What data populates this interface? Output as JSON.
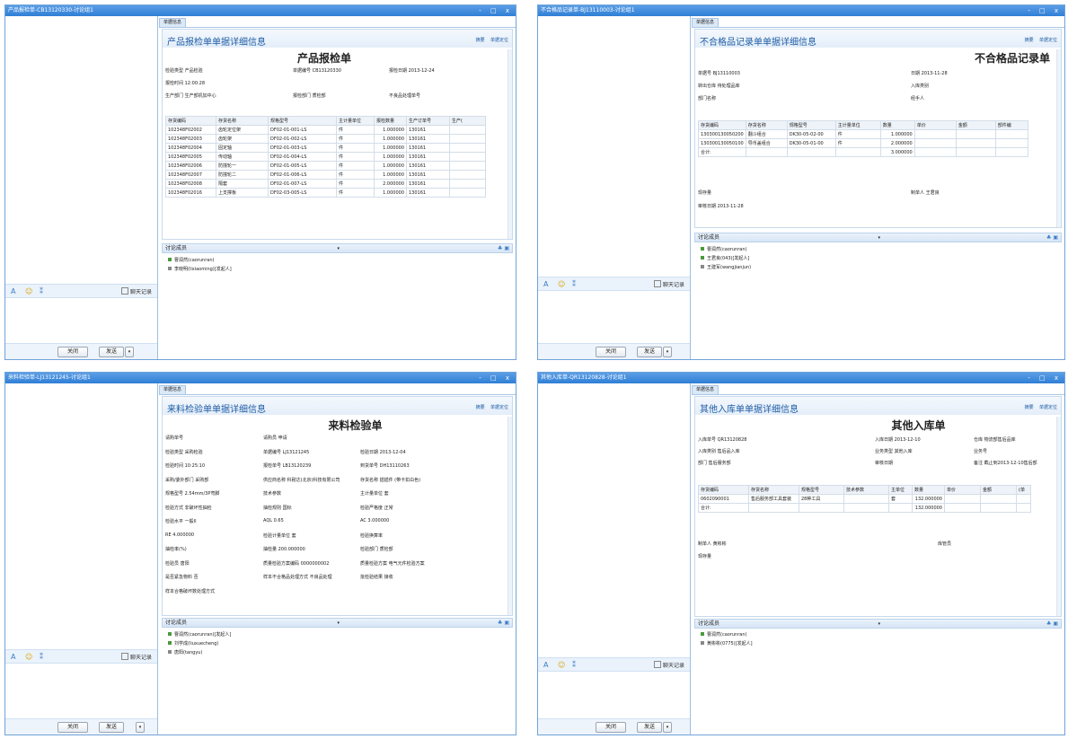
{
  "common": {
    "close_label": "关闭",
    "send_label": "发送",
    "chat_record_label": "聊天记录",
    "discussion_label": "讨论成员",
    "tab_label": "单据信息",
    "summary_link": "摘要",
    "locate_link": "单据定位",
    "window_controls": "- □ x",
    "dropdown_arrow": "▾",
    "font_icon": "A",
    "emoji_icon": "☺",
    "shake_icon": "⁑",
    "accent_color": "#2f7fd6"
  },
  "w1": {
    "title": "产品报检单-CB13120330-讨论组1",
    "doc_header": "产品报检单单据详细信息",
    "doc_title": "产品报检单",
    "fields": {
      "a1": "检验类型 产品检验",
      "a2": "单据编号 CB13120330",
      "a3": "报检日期 2013-12-24",
      "b1": "报检时间 12:00:28",
      "c1": "生产部门 生产部机加中心",
      "c2": "报检部门 质检部",
      "c3": "不良品处理单号"
    },
    "table": {
      "headers": [
        "存货编码",
        "存货名称",
        "规格型号",
        "主计量单位",
        "报检数量",
        "生产订单号",
        "生产("
      ],
      "rows": [
        [
          "102348F02002",
          "齿轮定位架",
          "DF02-01-001-LS",
          "件",
          "1.000000",
          "130161",
          ""
        ],
        [
          "102348F02003",
          "齿轮架",
          "DF02-01-002-LS",
          "件",
          "1.000000",
          "130161",
          ""
        ],
        [
          "102348F02004",
          "固定轴",
          "DF02-01-003-LS",
          "件",
          "1.000000",
          "130161",
          ""
        ],
        [
          "102348F02005",
          "传动轴",
          "DF02-01-004-LS",
          "件",
          "1.000000",
          "130161",
          ""
        ],
        [
          "102348F02006",
          "防撞轮一",
          "DF02-01-005-LS",
          "件",
          "1.000000",
          "130161",
          ""
        ],
        [
          "102348F02007",
          "防撞轮二",
          "DF02-01-006-LS",
          "件",
          "1.000000",
          "130161",
          ""
        ],
        [
          "102348F02008",
          "隔套",
          "DF02-01-007-LS",
          "件",
          "2.000000",
          "130161",
          ""
        ],
        [
          "102348F02016",
          "上支撑板",
          "DF02-03-005-LS",
          "件",
          "1.000000",
          "130161",
          ""
        ]
      ]
    },
    "members": [
      "曹润然(caorunran)",
      "李晓明(lixiaoming)[发起人]"
    ]
  },
  "w2": {
    "title": "不合格品记录单-BJ13110003-讨论组1",
    "doc_header": "不合格品记录单单据详细信息",
    "doc_title": "不合格品记录单",
    "fields": {
      "a1": "单据号 BJ13110003",
      "a2": "日期 2013-11-28",
      "b1": "转出仓库 待处理品库",
      "b2": "入库类别",
      "c1": "部门名称",
      "c2": "经手人",
      "d1": "现存量",
      "d2": "制单人 王君良",
      "e1": "审核日期 2013-11-28"
    },
    "table": {
      "headers": [
        "存货编码",
        "存货名称",
        "规格型号",
        "主计量单位",
        "数量",
        "单价",
        "金额",
        "部件编"
      ],
      "rows": [
        [
          "130300130050200",
          "翻斗组合",
          "DK30-05-02-00",
          "件",
          "1.000000",
          "",
          "",
          ""
        ],
        [
          "130300130050100",
          "导币盖组合",
          "DK30-05-01-00",
          "件",
          "2.000000",
          "",
          "",
          ""
        ],
        [
          "合计:",
          "",
          "",
          "",
          "3.000000",
          "",
          "",
          ""
        ]
      ]
    },
    "members": [
      "曹润然(caorunran)",
      "王君良(043)[发起人]",
      "王建军(wangjianjun)"
    ]
  },
  "w3": {
    "title": "来料检验单-LJ13121245-讨论组1",
    "doc_header": "来料检验单单据详细信息",
    "doc_title": "来料检验单",
    "fields": [
      [
        "请购单号",
        "请购员 申请",
        ""
      ],
      [
        "检验类型 采购检验",
        "单据编号 LJ13121245",
        "检验日期 2013-12-04"
      ],
      [
        "检验时间 10:25:10",
        "报检单号 LB13120239",
        "到货单号 DH13110263"
      ],
      [
        "采购/委外部门 采购部",
        "供应商名称 科耐达(北京)科技有限公司",
        "存货名称 插插件 (带卡扣白色)"
      ],
      [
        "规格型号 2.54mm/3P弯脚",
        "技术参数",
        "主计量单位 套"
      ],
      [
        "检验方式 非破坏性抽检",
        "抽检规则 国标",
        "检验严格度 正常"
      ],
      [
        "检验水平 一般II",
        "AQL 0.65",
        "AC 3.000000"
      ],
      [
        "RE 4.000000",
        "检验计量单位 套",
        "检验换算率"
      ],
      [
        "抽检率(%)",
        "抽检量 200.000000",
        "检验部门 质检部"
      ],
      [
        "检验员 唐阳",
        "质量检验方案编码 0000000002",
        "质量检验方案 电气元件检验方案"
      ],
      [
        "是否紧急物料 否",
        "样本不合格品处理方式 不良品处理",
        "批检验结果 接收"
      ],
      [
        "样本合格破坏数处理方式",
        "",
        ""
      ]
    ],
    "members": [
      "曹润然(caorunran)[发起人]",
      "刘学成(liuxuecheng)",
      "唐阳(tangyu)"
    ]
  },
  "w4": {
    "title": "其他入库单-QR13120828-讨论组1",
    "doc_header": "其他入库单单据详细信息",
    "doc_title": "其他入库单",
    "fields": {
      "a1": "入库单号 QR13120828",
      "a2": "入库日期 2013-12-10",
      "a3": "仓库 物流部售后品库",
      "b1": "入库类别 售后品入库",
      "b2": "业务类型 其他入库",
      "b3": "业务号",
      "c1": "部门 售后服务部",
      "c2": "审核日期",
      "c3": "备注 截止到2013-12-10售后部",
      "d1": "制单人 黄彬彬",
      "d2": "库管员",
      "e1": "现存量"
    },
    "table": {
      "headers": [
        "存货编码",
        "存货名称",
        "规格型号",
        "技术参数",
        "主单位",
        "数量",
        "单价",
        "金额",
        "(单"
      ],
      "rows": [
        [
          "0602090001",
          "售后服务部工具套装",
          "28种工具",
          "",
          "套",
          "132.000000",
          "",
          "",
          ""
        ],
        [
          "合计:",
          "",
          "",
          "",
          "",
          "132.000000",
          "",
          "",
          ""
        ]
      ]
    },
    "members": [
      "曹润然(caorunran)",
      "黄彬彬(0775)[发起人]"
    ]
  }
}
